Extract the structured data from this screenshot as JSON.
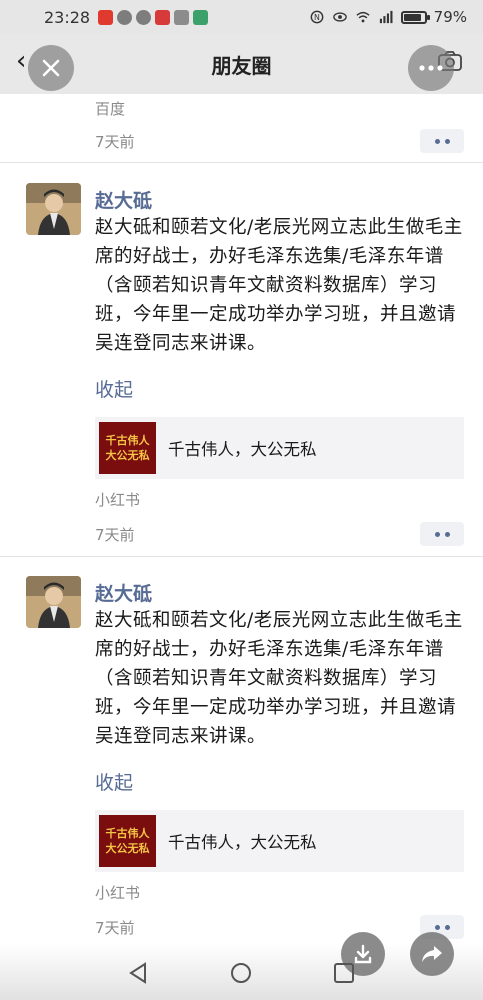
{
  "status_bar": {
    "time": "23:28",
    "battery": "79%",
    "battery_level": 0.79,
    "network": "4G"
  },
  "nav": {
    "title": "朋友圈",
    "back_icon": "chevron-left-icon",
    "camera_icon": "camera-icon"
  },
  "feed": {
    "top": {
      "source": "百度",
      "time": "7天前"
    },
    "posts": [
      {
        "user": "赵大砥",
        "text": "赵大砥和颐若文化/老辰光网立志此生做毛主席的好战士，办好毛泽东选集/毛泽东年谱（含颐若知识青年文献资料数据库）学习班，今年里一定成功举办学习班，并且邀请吴连登同志来讲课。",
        "collapse": "收起",
        "card_title": "千古伟人，大公无私",
        "card_thumb_line1": "千古伟人",
        "card_thumb_line2": "大公无私",
        "source": "小红书",
        "time": "7天前"
      },
      {
        "user": "赵大砥",
        "text": "赵大砥和颐若文化/老辰光网立志此生做毛主席的好战士，办好毛泽东选集/毛泽东年谱（含颐若知识青年文献资料数据库）学习班，今年里一定成功举办学习班，并且邀请吴连登同志来讲课。",
        "collapse": "收起",
        "card_title": "千古伟人，大公无私",
        "card_thumb_line1": "千古伟人",
        "card_thumb_line2": "大公无私",
        "source": "小红书",
        "time": "7天前"
      }
    ]
  },
  "colors": {
    "link": "#576b95",
    "meta": "#8a8a8a",
    "card_bg": "#f3f3f5"
  }
}
